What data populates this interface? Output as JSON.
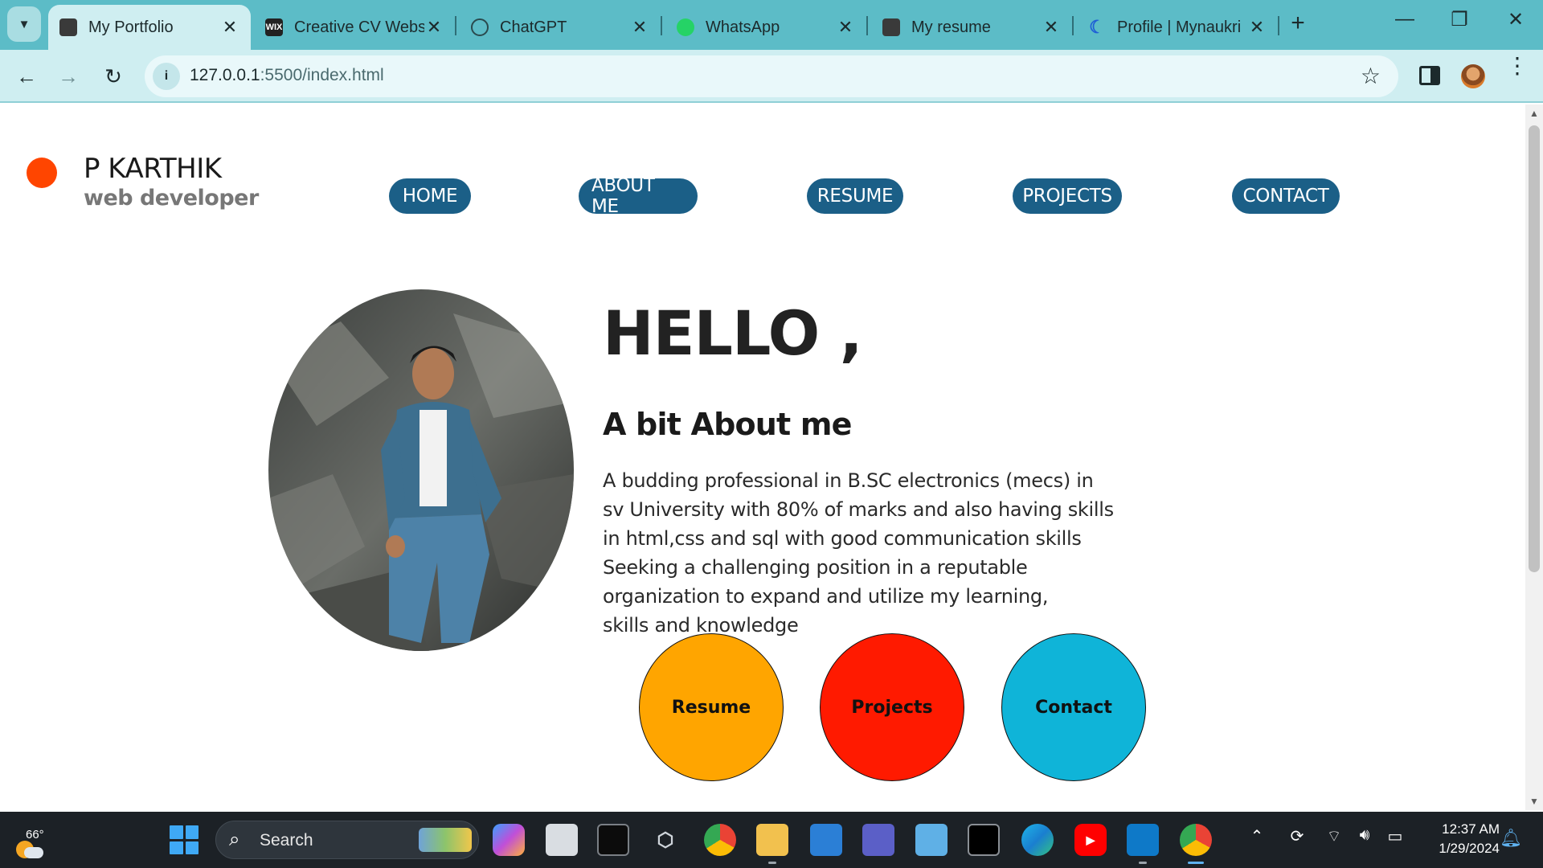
{
  "browser": {
    "tabs": [
      {
        "title": "My Portfolio",
        "active": true,
        "favicon": "portfolio-favicon-icon"
      },
      {
        "title": "Creative CV Websi",
        "active": false,
        "favicon": "wix-favicon-icon",
        "favicon_text": "WIX"
      },
      {
        "title": "ChatGPT",
        "active": false,
        "favicon": "chatgpt-favicon-icon"
      },
      {
        "title": "WhatsApp",
        "active": false,
        "favicon": "whatsapp-favicon-icon"
      },
      {
        "title": "My resume",
        "active": false,
        "favicon": "resume-favicon-icon"
      },
      {
        "title": "Profile | Mynaukri",
        "active": false,
        "favicon": "naukri-favicon-icon"
      }
    ],
    "address": {
      "host": "127.0.0.1",
      "path": ":5500/index.html"
    },
    "colors": {
      "tabstrip": "#5cbcc7",
      "toolbar": "#cfeef1"
    }
  },
  "page": {
    "brand": {
      "name": "P KARTHIK",
      "role": "web developer",
      "dot_color": "#ff4500"
    },
    "nav": [
      "HOME",
      "ABOUT ME",
      "RESUME",
      "PROJECTS",
      "CONTACT"
    ],
    "nav_color": "#1b5f87",
    "greeting": "HELLO ,",
    "about_heading": "A bit About me",
    "about_lines": [
      "A budding professional in B.SC electronics (mecs) in",
      "sv University with 80% of marks and also having skills",
      "in html,css and sql with good communication skills",
      "Seeking a challenging position in a reputable",
      "organization to expand and utilize my learning,",
      "skills and knowledge"
    ],
    "cta_buttons": [
      {
        "label": "Resume",
        "color": "#ffa500"
      },
      {
        "label": "Projects",
        "color": "#ff1a00"
      },
      {
        "label": "Contact",
        "color": "#0fb4d8"
      }
    ]
  },
  "taskbar": {
    "weather_temp": "66°",
    "search_label": "Search",
    "time": "12:37 AM",
    "date": "1/29/2024"
  }
}
